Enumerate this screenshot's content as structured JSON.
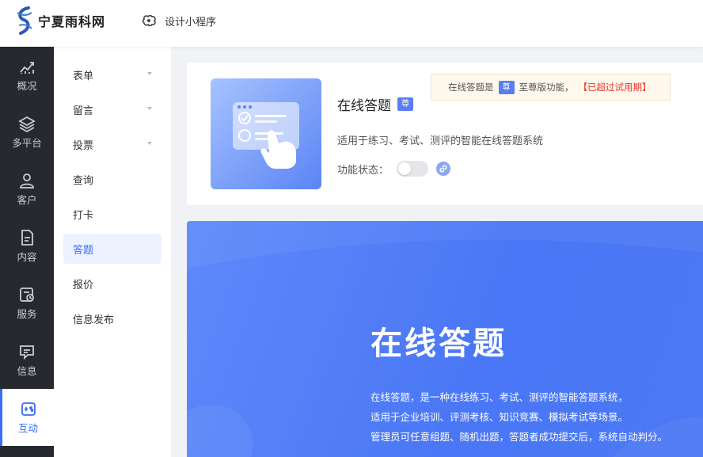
{
  "brand": {
    "name": "宁夏雨科网",
    "accent": "#3a6cf4"
  },
  "header": {
    "mini_program_label": "设计小程序",
    "mini_program_icon": "program-icon"
  },
  "rail": {
    "items": [
      {
        "label": "概况",
        "icon": "chart-icon"
      },
      {
        "label": "多平台",
        "icon": "layers-icon"
      },
      {
        "label": "客户",
        "icon": "user-icon"
      },
      {
        "label": "内容",
        "icon": "document-icon"
      },
      {
        "label": "服务",
        "icon": "service-icon"
      },
      {
        "label": "信息",
        "icon": "message-icon"
      },
      {
        "label": "互动",
        "icon": "interact-icon",
        "active": true
      }
    ]
  },
  "submenu": {
    "items": [
      {
        "label": "表单",
        "expandable": true
      },
      {
        "label": "留言",
        "expandable": true
      },
      {
        "label": "投票",
        "expandable": true
      },
      {
        "label": "查询"
      },
      {
        "label": "打卡"
      },
      {
        "label": "答题",
        "active": true
      },
      {
        "label": "报价"
      },
      {
        "label": "信息发布"
      }
    ]
  },
  "card": {
    "title": "在线答题",
    "vip_badge": "尊",
    "description": "适用于练习、考试、测评的智能在线答题系统",
    "status_label": "功能状态：",
    "enabled": false
  },
  "notice": {
    "prefix": "在线答题是",
    "badge": "尊",
    "suffix": "至尊版功能，",
    "warning": "【已超过试用期】",
    "warning_color": "#e5362c"
  },
  "banner": {
    "title": "在线答题",
    "lines": [
      "在线答题，是一种在线练习、考试、测评的智能答题系统，",
      "适用于企业培训、评测考核、知识竞赛、模拟考试等场景。",
      "管理员可任意组题、随机出题，答题者成功提交后，系统自动判分。"
    ]
  }
}
